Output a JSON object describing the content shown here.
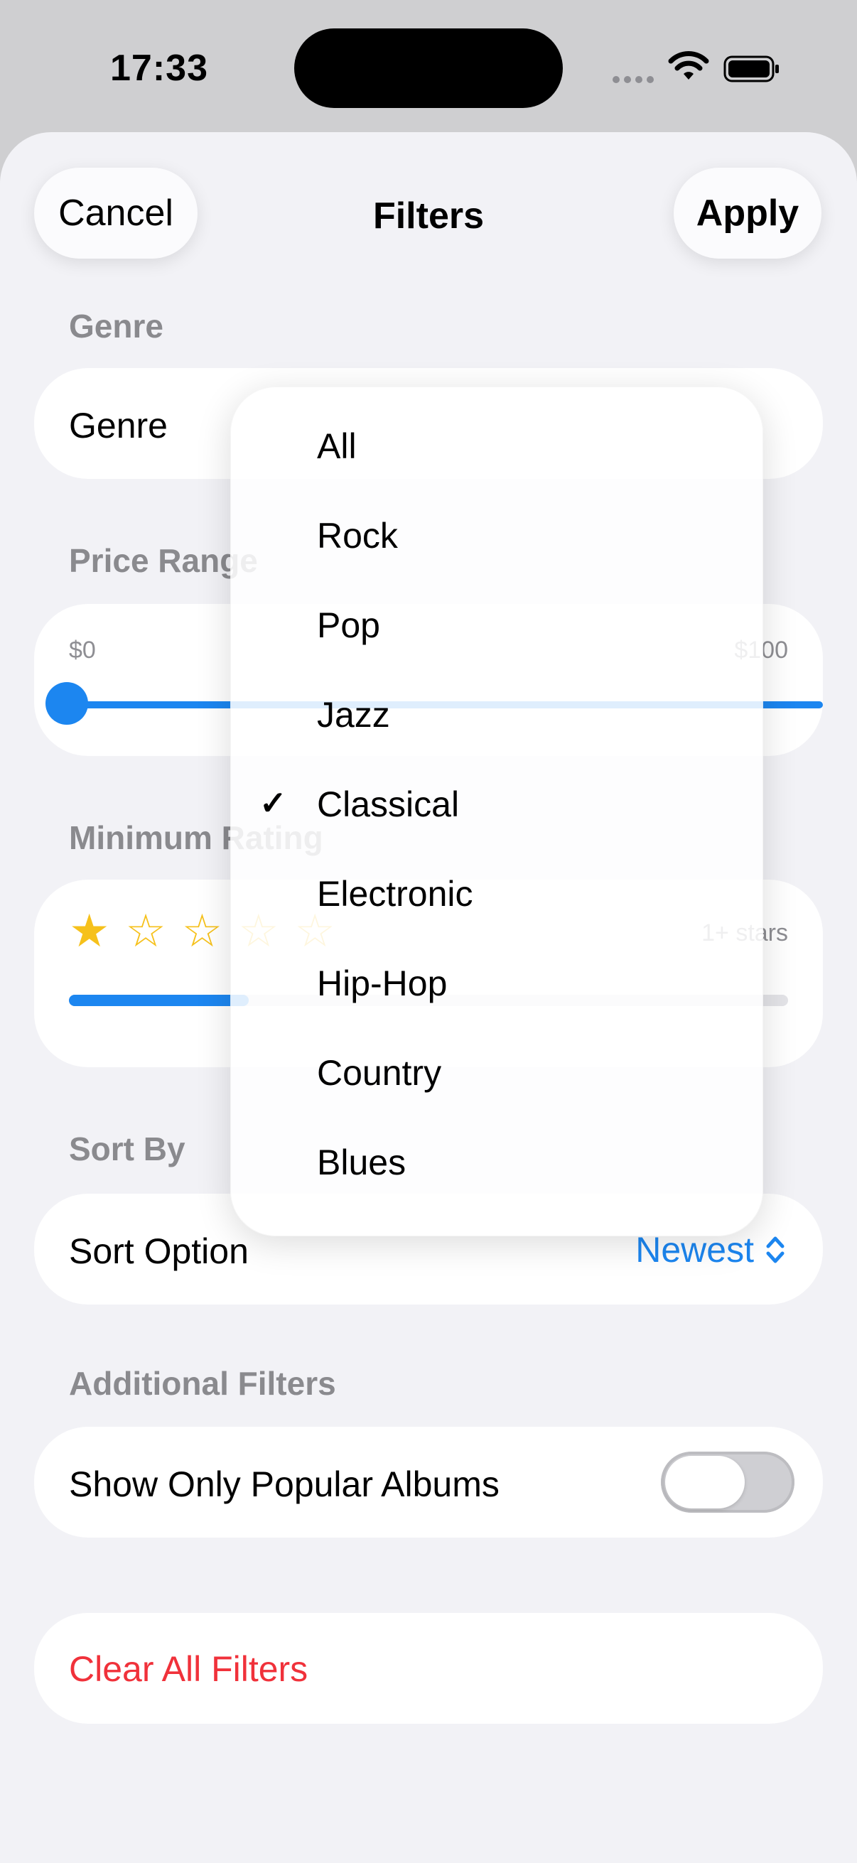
{
  "status_bar": {
    "time": "17:33"
  },
  "nav": {
    "cancel_label": "Cancel",
    "title": "Filters",
    "apply_label": "Apply"
  },
  "genre": {
    "header": "Genre",
    "row_label": "Genre"
  },
  "price": {
    "header": "Price Range",
    "min_label": "$0",
    "max_label": "$100"
  },
  "rating": {
    "header": "Minimum Rating",
    "value_stars": 1,
    "max_stars": 5,
    "value_text": "1+ stars",
    "fill_fraction": 0.25
  },
  "sort": {
    "header": "Sort By",
    "row_label": "Sort Option",
    "value": "Newest"
  },
  "additional": {
    "header": "Additional Filters",
    "popular_label": "Show Only Popular Albums",
    "popular_enabled": false
  },
  "clear": {
    "label": "Clear All Filters"
  },
  "genre_menu": {
    "items": [
      {
        "label": "All",
        "selected": false
      },
      {
        "label": "Rock",
        "selected": false
      },
      {
        "label": "Pop",
        "selected": false
      },
      {
        "label": "Jazz",
        "selected": false
      },
      {
        "label": "Classical",
        "selected": true
      },
      {
        "label": "Electronic",
        "selected": false
      },
      {
        "label": "Hip-Hop",
        "selected": false
      },
      {
        "label": "Country",
        "selected": false
      },
      {
        "label": "Blues",
        "selected": false
      }
    ],
    "check_symbol": "✓"
  },
  "colors": {
    "accent": "#1c86f0",
    "destructive": "#f0313a",
    "star": "#f6c11b",
    "secondary_text": "#8a8a8e"
  },
  "icons": {
    "wifi": "wifi-icon",
    "battery": "battery-icon",
    "chevron": "chevron-up-down-icon",
    "star_filled": "★",
    "star_empty": "☆"
  }
}
